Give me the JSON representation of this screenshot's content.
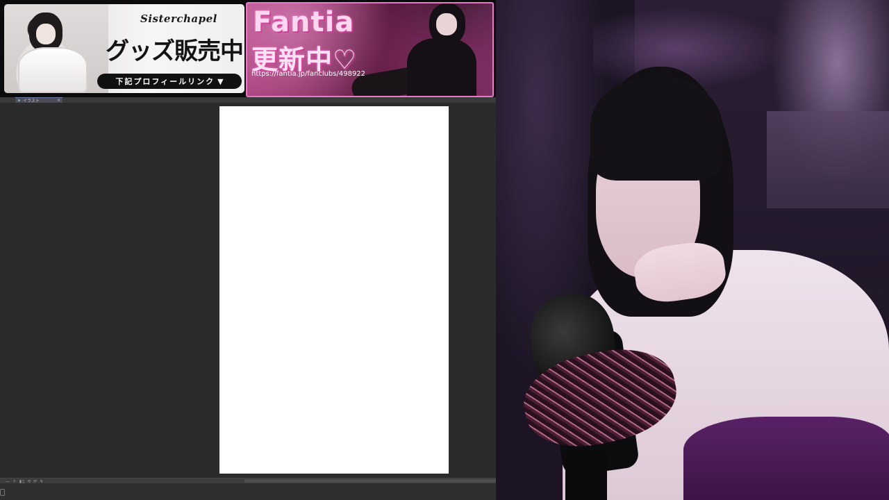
{
  "goods_banner": {
    "logo": "Sisterchapel",
    "headline": "グッズ販売中",
    "link_label": "下記プロフィールリンク",
    "link_arrow": "▼"
  },
  "fantia_banner": {
    "title": "Fantia",
    "subtitle": "更新中♡",
    "url": "https://fantia.jp/fanclubs/498922"
  },
  "drawing_app": {
    "tab_label": "イラスト",
    "tab_close": "×",
    "status_controls": "— ＋ ▮▯ ⟲ ⟳ ↯"
  },
  "colors": {
    "canvas_bg": "#2b2b2b",
    "paper": "#ffffff",
    "fantia_border": "#e87ac8",
    "webcam_bg": "#251a2e"
  }
}
